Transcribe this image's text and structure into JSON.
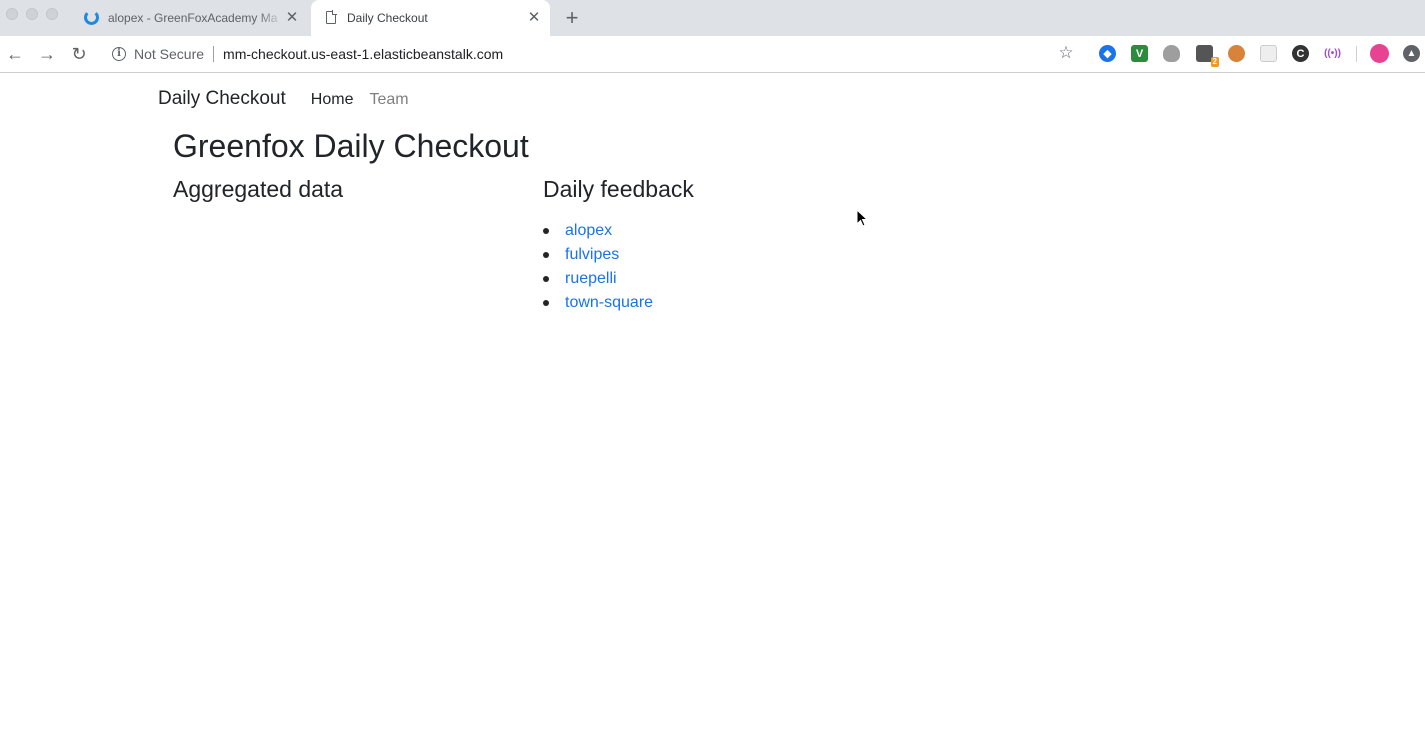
{
  "browser": {
    "tabs": [
      {
        "title": "alopex - GreenFoxAcademy Ma",
        "icon": "mattermost-icon",
        "active": false
      },
      {
        "title": "Daily Checkout",
        "icon": "document-icon",
        "active": true
      }
    ],
    "new_tab": "+",
    "close_glyph": "✕",
    "security_label": "Not Secure",
    "url": "mm-checkout.us-east-1.elasticbeanstalk.com",
    "extension_badge": "2"
  },
  "site": {
    "brand": "Daily Checkout",
    "nav": [
      {
        "label": "Home",
        "active": true
      },
      {
        "label": "Team",
        "active": false
      }
    ],
    "title": "Greenfox Daily Checkout",
    "aggregated_heading": "Aggregated data",
    "feedback_heading": "Daily feedback",
    "channels": [
      "alopex",
      "fulvipes",
      "ruepelli",
      "town-square"
    ]
  },
  "colors": {
    "link": "#1a73e8",
    "text": "#212529",
    "muted_nav": "#7f7f7f",
    "tabstrip": "#dee1e6"
  }
}
